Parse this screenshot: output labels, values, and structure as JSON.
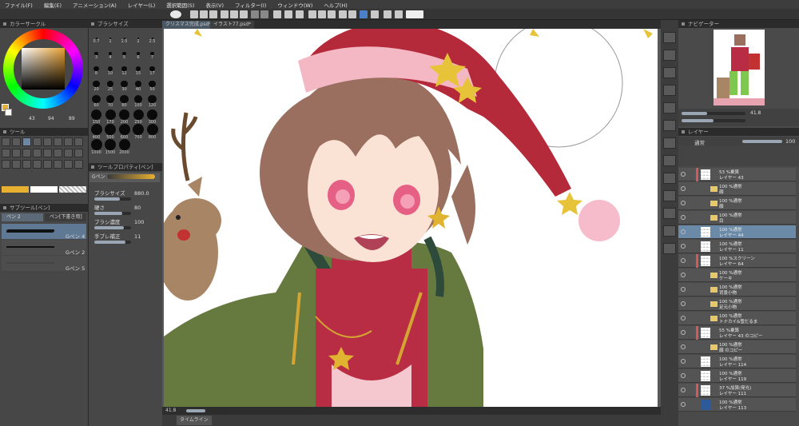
{
  "menu": [
    "ファイル(F)",
    "編集(E)",
    "アニメーション(A)",
    "レイヤー(L)",
    "選択範囲(S)",
    "表示(V)",
    "フィルター(I)",
    "ウィンドウ(W)",
    "ヘルプ(H)"
  ],
  "panels": {
    "color_wheel": "カラーサークル",
    "brush_size": "ブラシサイズ",
    "tool": "ツール",
    "sub_tool": "サブツール[ペン]",
    "tool_property": "ツールプロパティ[ペン]",
    "navigator": "ナビゲーター",
    "layer": "レイヤー"
  },
  "color": {
    "value_text": "94",
    "value2_text": "89",
    "num1": "43"
  },
  "brush_sizes": [
    "0.7",
    "1",
    "1.5",
    "2",
    "2.5",
    "3",
    "4",
    "5",
    "6",
    "7",
    "8",
    "10",
    "12",
    "15",
    "17",
    "20",
    "25",
    "30",
    "40",
    "50",
    "60",
    "70",
    "80",
    "100",
    "120",
    "150",
    "170",
    "200",
    "250",
    "300",
    "400",
    "500",
    "600",
    "700",
    "800",
    "1000",
    "1500",
    "2000"
  ],
  "sub_tool": {
    "tab1": "ペン 2",
    "tab2": "ペン[下書き用]",
    "items": [
      "Gペン 4",
      "Gペン 2",
      "Gペン 5"
    ]
  },
  "tool_property": {
    "tool_name": "Gペン 4",
    "rows": [
      {
        "label": "ブラシサイズ",
        "value": "880.0"
      },
      {
        "label": "硬さ",
        "value": "80"
      },
      {
        "label": "ブラシ濃度",
        "value": "100"
      },
      {
        "label": "手ブレ補正",
        "value": "11"
      }
    ]
  },
  "canvas_tabs": [
    "クリスマス完成.psd*",
    "イラスト77.psd*"
  ],
  "status": {
    "zoom": "41.8",
    "tl": "タイムライン"
  },
  "navigator_zoom": "41.8",
  "layer_panel": {
    "blend": "通常",
    "opacity": "100",
    "layers": [
      {
        "pct": "53 %乗算",
        "name": "レイヤー 43",
        "type": "layer",
        "red": true
      },
      {
        "pct": "100 %通常",
        "name": "顔",
        "type": "folder"
      },
      {
        "pct": "100 %通常",
        "name": "顔",
        "type": "folder"
      },
      {
        "pct": "100 %通常",
        "name": "目",
        "type": "folder"
      },
      {
        "pct": "100 %通常",
        "name": "レイヤー 44",
        "type": "layer",
        "sel": true
      },
      {
        "pct": "100 %通常",
        "name": "レイヤー 11",
        "type": "layer"
      },
      {
        "pct": "100 %スクリーン",
        "name": "レイヤー 64",
        "type": "layer",
        "red": true
      },
      {
        "pct": "100 %通常",
        "name": "ケーキ",
        "type": "folder"
      },
      {
        "pct": "100 %通常",
        "name": "背景小物",
        "type": "folder"
      },
      {
        "pct": "100 %通常",
        "name": "足元小物",
        "type": "folder"
      },
      {
        "pct": "100 %通常",
        "name": "トナカイ&雪だるま",
        "type": "folder"
      },
      {
        "pct": "55 %乗算",
        "name": "レイヤー 43 のコピー",
        "type": "layer",
        "red": true
      },
      {
        "pct": "100 %通常",
        "name": "顔 のコピー",
        "type": "folder"
      },
      {
        "pct": "100 %通常",
        "name": "レイヤー 114",
        "type": "layer"
      },
      {
        "pct": "100 %通常",
        "name": "レイヤー 119",
        "type": "layer"
      },
      {
        "pct": "37 %加算(発光)",
        "name": "レイヤー 111",
        "type": "layer",
        "red": true
      },
      {
        "pct": "100 %通常",
        "name": "レイヤー 113",
        "type": "layer",
        "blue": true
      }
    ]
  }
}
